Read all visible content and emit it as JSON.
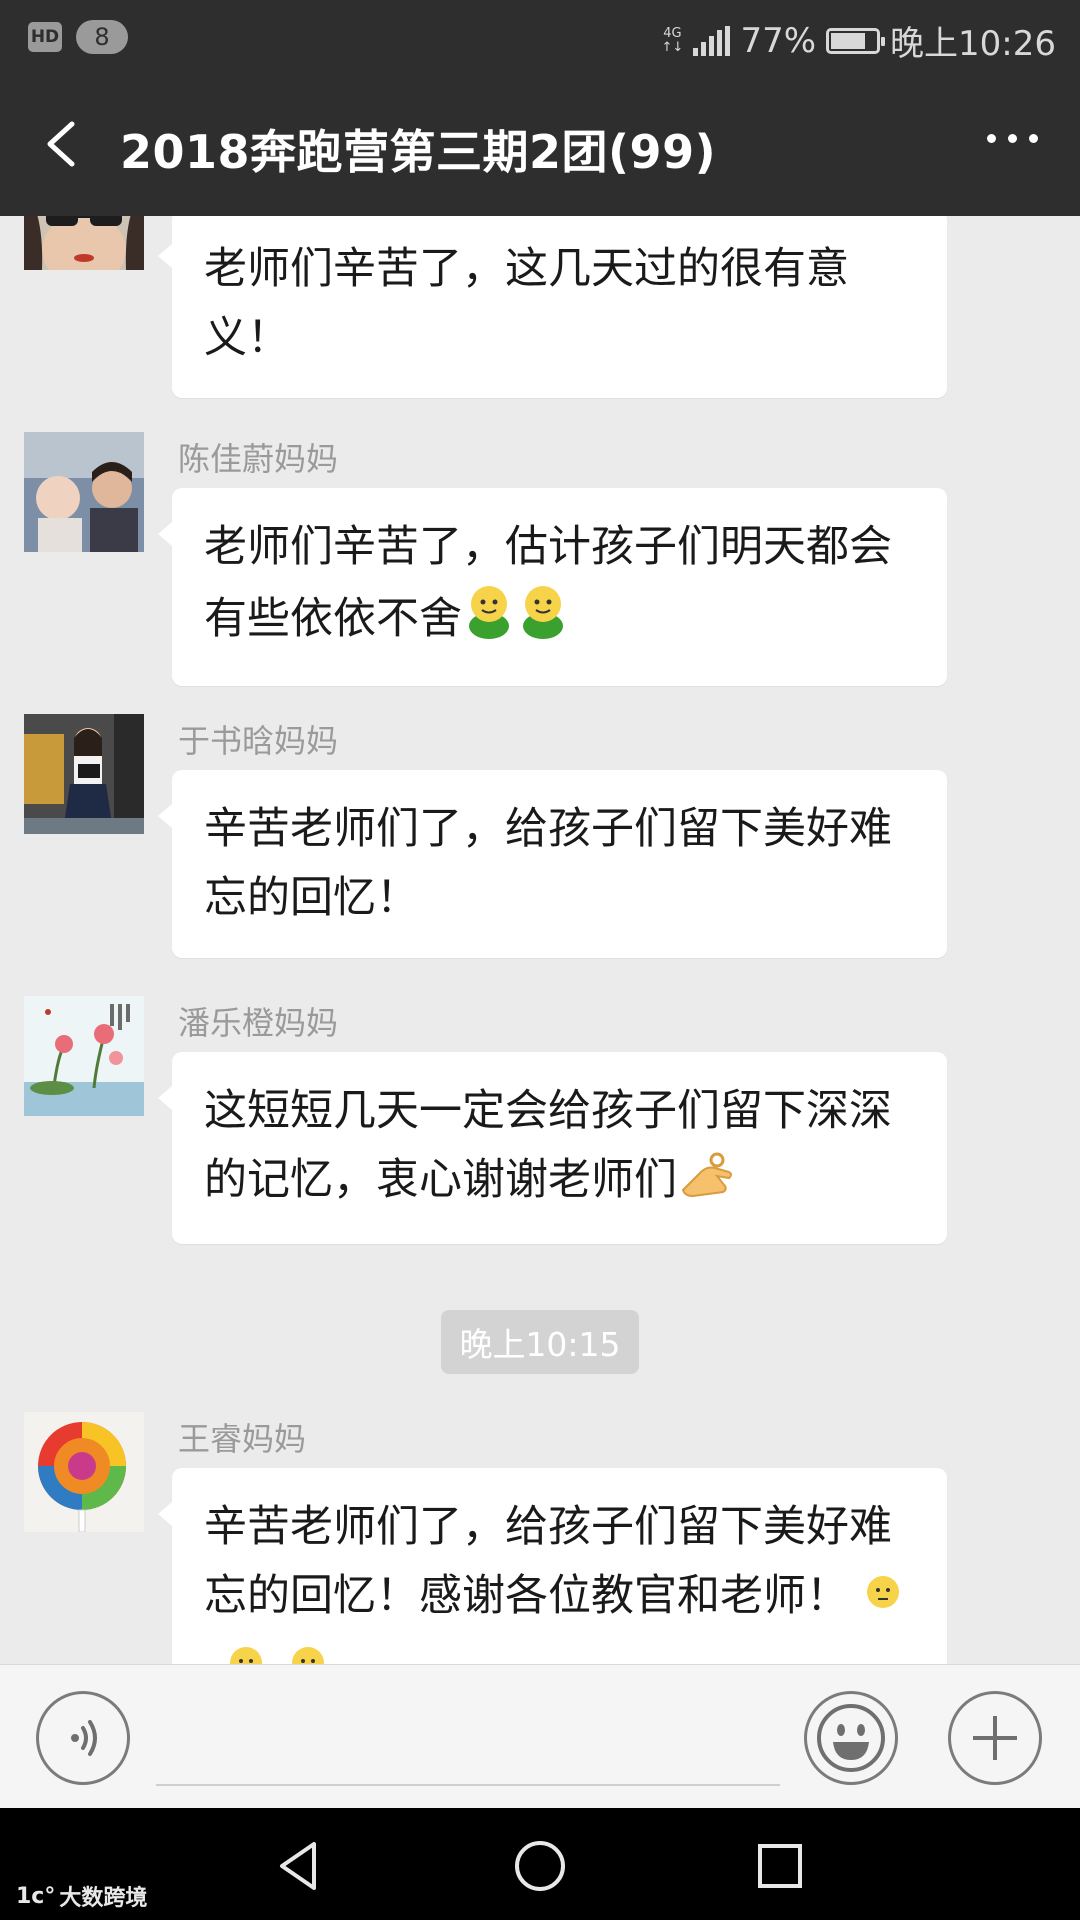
{
  "status_bar": {
    "hd_label": "HD",
    "notification_count": "8",
    "network": "4G",
    "network_sub": "↑↓",
    "battery_percent": "77%",
    "battery_level": 0.77,
    "time": "晚上10:26"
  },
  "title_bar": {
    "title": "2018奔跑营第三期2团(99)",
    "back_icon": "chevron-left-icon",
    "more_icon": "more-horizontal-icon"
  },
  "messages": [
    {
      "sender": "",
      "text": "老师们辛苦了，这几天过的很有意义！"
    },
    {
      "sender": "陈佳蔚妈妈",
      "text": "老师们辛苦了，估计孩子们明天都会有些依依不舍"
    },
    {
      "sender": "于书晗妈妈",
      "text": "辛苦老师们了，给孩子们留下美好难忘的回忆！"
    },
    {
      "sender": "潘乐橙妈妈",
      "text": "这短短几天一定会给孩子们留下深深的记忆，衷心谢谢老师们"
    },
    {
      "sender": "王睿妈妈",
      "text": "辛苦老师们了，给孩子们留下美好难忘的回忆！感谢各位教官和老师！"
    }
  ],
  "time_divider": "晚上10:15",
  "input_bar": {
    "voice_icon": "voice-icon",
    "emoji_icon": "smiley-icon",
    "plus_icon": "plus-icon"
  },
  "nav_bar": {
    "back_icon": "triangle-back-icon",
    "home_icon": "circle-home-icon",
    "recents_icon": "square-recents-icon"
  },
  "watermark": {
    "logo": "1c°",
    "text": "大数跨境"
  },
  "colors": {
    "header_bg": "#2e2e2e",
    "chat_bg": "#ebebeb",
    "bubble_bg": "#ffffff",
    "emoji_green": "#3aa02e",
    "emoji_yellow": "#f7d34a"
  }
}
